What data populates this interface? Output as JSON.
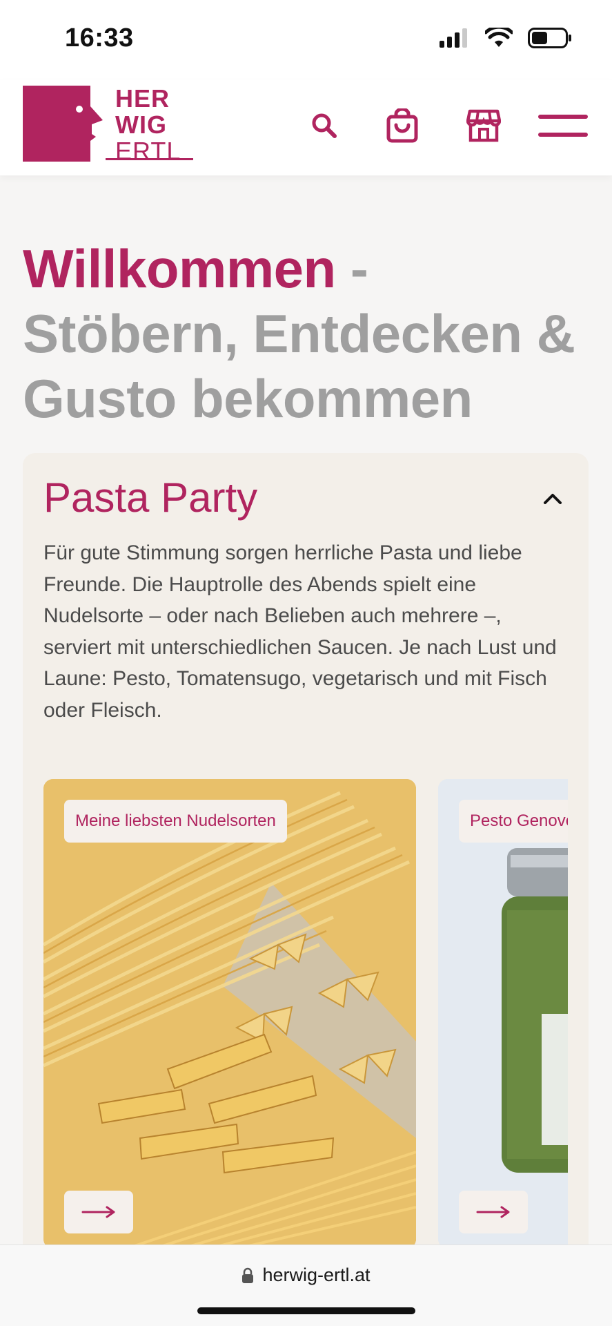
{
  "status": {
    "time": "16:33"
  },
  "header": {
    "logo": {
      "line1": "HER",
      "line2": "WIG",
      "line3": "ERTL"
    },
    "icons": [
      "search-icon",
      "shopping-bag-icon",
      "store-icon",
      "menu-icon"
    ],
    "brand_color": "#b0245f"
  },
  "headline": {
    "accent": "Willkommen",
    "rest": " - Stöbern, Entdecken & Gusto bekommen"
  },
  "card": {
    "title": "Pasta Party",
    "text": "Für gute Stimmung sorgen herrliche Pasta und liebe Freunde. Die Hauptrolle des Abends spielt eine Nudelsorte – oder nach Belieben auch mehrere –, serviert mit unterschiedlichen Saucen. Je nach Lust und Laune: Pesto, Tomatensugo, vegetarisch und mit Fisch oder Fleisch.",
    "slides": [
      {
        "label": "Meine liebsten Nudelsorten"
      },
      {
        "label": "Pesto Genovese"
      }
    ]
  },
  "browser": {
    "url": "herwig-ertl.at"
  }
}
